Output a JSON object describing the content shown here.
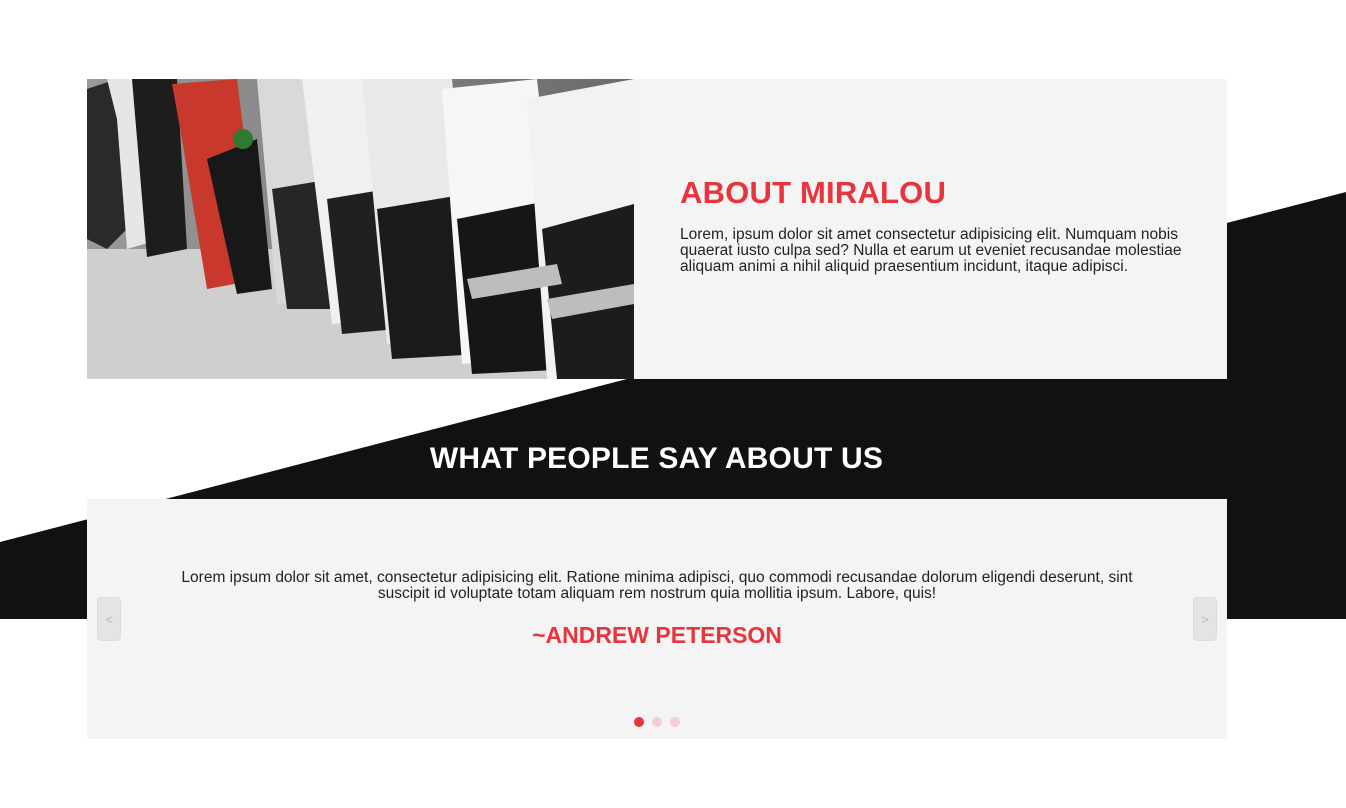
{
  "about": {
    "title": "ABOUT MIRALOU",
    "body": "Lorem, ipsum dolor sit amet consectetur adipisicing elit. Numquam nobis quaerat iusto culpa sed? Nulla et earum ut eveniet recusandae molestiae aliquam animi a nihil aliquid praesentium incidunt, itaque adipisci.",
    "image": "sneakers-row-photo"
  },
  "reviews": {
    "heading": "WHAT PEOPLE SAY ABOUT US",
    "quote": "Lorem ipsum dolor sit amet, consectetur adipisicing elit. Ratione minima adipisci, quo commodi recusandae dolorum eligendi deserunt, sint suscipit id voluptate totam aliquam rem nostrum quia mollitia ipsum. Labore, quis!",
    "author": "~ANDREW PETERSON",
    "prev_label": "<",
    "next_label": ">",
    "slide_count": 3,
    "active_slide": 1
  },
  "colors": {
    "accent": "#e8343c",
    "dark": "#111111",
    "panel": "#f4f4f4"
  }
}
